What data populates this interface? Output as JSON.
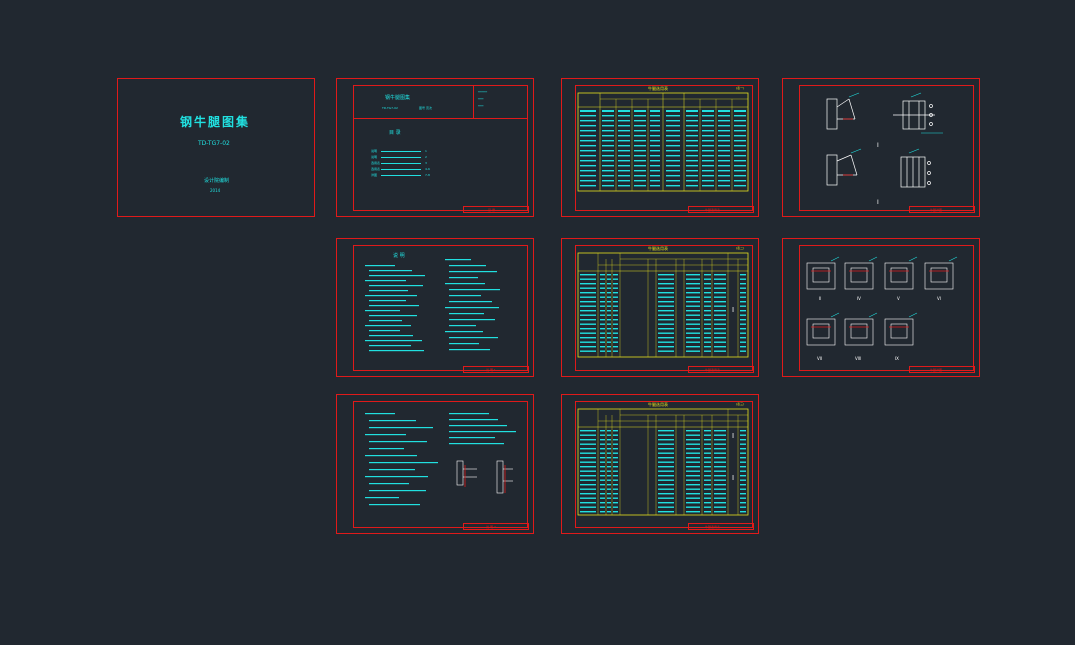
{
  "cover": {
    "title": "钢牛腿图集",
    "code": "TD-TG7-02",
    "publisher": "设计院编制",
    "year": "2014"
  },
  "contents_sheet": {
    "header": "钢牛腿图集",
    "sub1": "TD-TG7-02",
    "sub2": "图号  页次",
    "section": "目 录",
    "entries": [
      "说明",
      "说明",
      "选用表",
      "选用表",
      "详图"
    ],
    "pages": [
      "1",
      "2",
      "3",
      "4-6",
      "7-8"
    ],
    "footer": "目 录"
  },
  "notes_sheet": {
    "title": "说 明",
    "footer": "说 明 1"
  },
  "notes2_sheet": {
    "footer": "说 明 2"
  },
  "table1_sheet": {
    "title": "牛腿选用表",
    "tag": "(表一)",
    "footer": "牛腿选用表"
  },
  "table2_sheet": {
    "title": "牛腿选用表",
    "tag": "(表二)",
    "footer": "牛腿选用表",
    "roman": "I"
  },
  "table3_sheet": {
    "title": "牛腿选用表",
    "tag": "(表三)",
    "footer": "牛腿选用表",
    "roman_a": "I",
    "roman_b": "I"
  },
  "detail1_sheet": {
    "label_a": "I",
    "label_b": "I",
    "footer": "牛腿详图"
  },
  "detail2_sheet": {
    "labels": [
      "II",
      "IV",
      "V",
      "VI",
      "VII",
      "VIII",
      "IX"
    ],
    "footer": "牛腿详图"
  },
  "colors": {
    "background": "#212830",
    "border": "#e01a1a",
    "text": "#21e0e0",
    "table": "#e6e020",
    "drawing": "#ffffff"
  }
}
